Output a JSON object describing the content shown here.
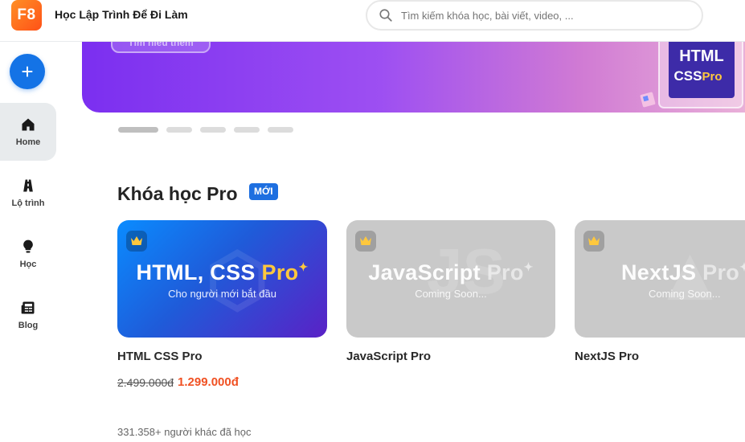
{
  "header": {
    "logo_text": "F8",
    "brand": "Học Lập Trình Để Đi Làm",
    "search_placeholder": "Tìm kiếm khóa học, bài viết, video, ..."
  },
  "sidebar": {
    "add_label": "+",
    "items": [
      {
        "label": "Home",
        "icon": "home-icon",
        "active": true
      },
      {
        "label": "Lộ trình",
        "icon": "road-icon",
        "active": false
      },
      {
        "label": "Học",
        "icon": "lightbulb-icon",
        "active": false
      },
      {
        "label": "Blog",
        "icon": "newspaper-icon",
        "active": false
      }
    ]
  },
  "banner": {
    "button_label": "Tìm hiểu thêm",
    "art_text_top": "HTML",
    "art_text_bottom": "CSS",
    "art_text_pro": "Pro"
  },
  "section": {
    "title": "Khóa học Pro",
    "badge": "MỚI"
  },
  "courses": [
    {
      "headline": "HTML, CSS",
      "pro": "Pro",
      "sub": "Cho người mới bắt đầu",
      "title": "HTML CSS Pro",
      "old_price": "2.499.000đ",
      "new_price": "1.299.000đ",
      "learners_count": "331.358+",
      "learners_text": "người khác đã học"
    },
    {
      "headline": "JavaScript",
      "pro": "Pro",
      "sub": "Coming Soon...",
      "title": "JavaScript Pro"
    },
    {
      "headline": "NextJS",
      "pro": "Pro",
      "sub": "Coming Soon...",
      "title": "NextJS Pro"
    }
  ],
  "colors": {
    "accent": "#1473e6",
    "price": "#f05123",
    "logo": "#ff5117"
  }
}
